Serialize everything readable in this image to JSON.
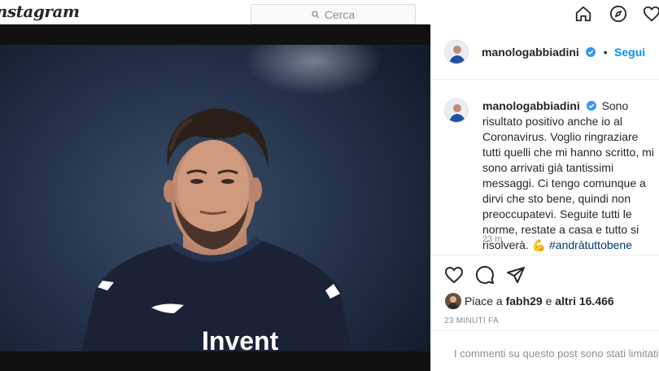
{
  "nav": {
    "logo_text": "Instagram",
    "search_placeholder": "Cerca",
    "icons": [
      "home-icon",
      "explore-compass-icon",
      "activity-heart-icon"
    ]
  },
  "post": {
    "username": "manologabbiadini",
    "follow_label": "Segui",
    "separator": "•",
    "caption": "Sono risultato positivo anche io al Coronavirus. Voglio ringraziare tutti quelli che mi hanno scritto, mi sono arrivati già tantissimi messaggi. Ci tengo comunque a dirvi che sto bene, quindi non preoccupatevi. Seguite tutti le norme, restate a casa e tutto si risolverà.",
    "emoji": "💪",
    "hashtag": "#andràtuttobene",
    "time_ago": "23 m",
    "likes_prefix": "Piace a",
    "likes_user": "fabh29",
    "likes_middle": "e",
    "likes_others": "altri 16.466",
    "date": "23 MINUTI FA",
    "comments_notice": "I commenti su questo post sono stati limitati.",
    "photo_shirt_text": "Invent"
  },
  "colors": {
    "accent": "#0095f6",
    "verified": "#3897f0",
    "hashtag": "#00376b",
    "muted": "#8e8e8e"
  }
}
